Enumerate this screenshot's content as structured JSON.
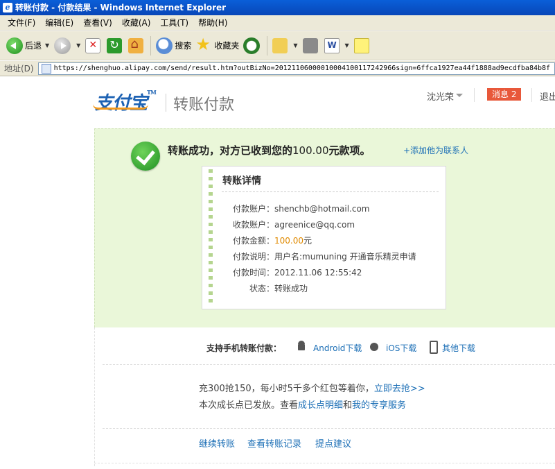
{
  "window": {
    "title": "转账付款 - 付款结果 - Windows Internet Explorer"
  },
  "menu": [
    "文件(F)",
    "编辑(E)",
    "查看(V)",
    "收藏(A)",
    "工具(T)",
    "帮助(H)"
  ],
  "toolbar": {
    "back_label": "后退",
    "search_label": "搜索",
    "favorites_label": "收藏夹"
  },
  "address": {
    "label": "地址(D)",
    "url": "https://shenghuo.alipay.com/send/result.htm?outBizNo=20121106000010004100117242966sign=6ffca1927ea44f1888ad9ecdfba84b8f"
  },
  "header": {
    "logo_text": "支付宝",
    "logo_tm": "TM",
    "page_title": "转账付款",
    "user_name": "沈光荣",
    "messages_label": "消息 2",
    "logout_label": "退出"
  },
  "result": {
    "title_prefix": "转账成功，对方已收到您的",
    "amount_text": "100.00",
    "title_suffix": "元款项。",
    "add_contact_label": "+添加他为联系人"
  },
  "details": {
    "title": "转账详情",
    "rows": [
      {
        "label": "付款账户：",
        "value": "shenchb@hotmail.com"
      },
      {
        "label": "收款账户：",
        "value": "agreenice@qq.com"
      },
      {
        "label": "付款金额：",
        "value": "100.00",
        "unit": "元"
      },
      {
        "label": "付款说明：",
        "value": "用户名:mumuning 开通音乐精灵申请"
      },
      {
        "label": "付款时间：",
        "value": "2012.11.06 12:55:42"
      },
      {
        "label": "状态：",
        "value": "转账成功"
      }
    ]
  },
  "mobile": {
    "title": "支持手机转账付款：",
    "android_label": "Android下载",
    "ios_label": "iOS下载",
    "other_label": "其他下载"
  },
  "promo": {
    "line1_text": "充300抢150，每小时5千多个红包等着你，",
    "line1_link": "立即去抢>>",
    "line2_prefix": "本次成长点已发放。查看",
    "line2_link1": "成长点明细",
    "line2_and": "和",
    "line2_link2": "我的专享服务"
  },
  "footer": {
    "continue_label": "继续转账",
    "records_label": "查看转账记录",
    "feedback_label": "提点建议"
  },
  "colors": {
    "link": "#1c6fb6",
    "success_bg": "#eaf7d9",
    "amount": "#e08a00",
    "badge": "#e8583a"
  }
}
